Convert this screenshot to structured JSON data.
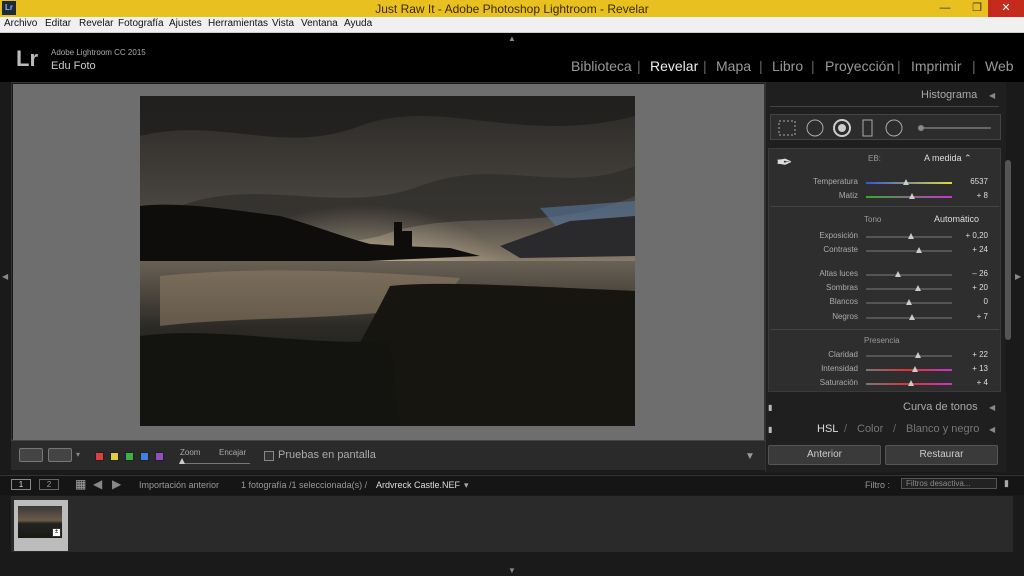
{
  "window": {
    "title": "Just Raw It - Adobe Photoshop Lightroom - Revelar",
    "app_icon": "Lr",
    "minimize": "—",
    "maximize": "❐",
    "close": "✕"
  },
  "menu": [
    "Archivo",
    "Editar",
    "Revelar",
    "Fotografía",
    "Ajustes",
    "Herramientas",
    "Vista",
    "Ventana",
    "Ayuda"
  ],
  "identity": {
    "logo": "Lr",
    "version": "Adobe Lightroom CC 2015",
    "user": "Edu Foto"
  },
  "modules": [
    {
      "label": "Biblioteca",
      "active": false
    },
    {
      "label": "Revelar",
      "active": true
    },
    {
      "label": "Mapa",
      "active": false
    },
    {
      "label": "Libro",
      "active": false
    },
    {
      "label": "Proyección",
      "active": false
    },
    {
      "label": "Imprimir",
      "active": false
    },
    {
      "label": "Web",
      "active": false
    }
  ],
  "module_separator": "|",
  "toolbar": {
    "zoom_label": "Zoom",
    "fit_label": "Encajar",
    "proofing_label": "Pruebas en pantalla",
    "swatches": [
      "#d94040",
      "#e0d040",
      "#40b040",
      "#4080e0",
      "#9050c0"
    ]
  },
  "panel": {
    "histogram_title": "Histograma",
    "wb_label": "EB:",
    "wb_value": "A medida ⌃",
    "temp_sliders": [
      {
        "label": "Temperatura",
        "value": "6537",
        "pos": 0.47,
        "gradient": "linear-gradient(90deg,#3355dd,#dddd33)"
      },
      {
        "label": "Matiz",
        "value": "+ 8",
        "pos": 0.53,
        "gradient": "linear-gradient(90deg,#33aa33,#cc33cc)"
      }
    ],
    "tone_label": "Tono",
    "auto_label": "Automático",
    "tone_sliders": [
      {
        "label": "Exposición",
        "value": "+ 0,20",
        "pos": 0.52
      },
      {
        "label": "Contraste",
        "value": "+ 24",
        "pos": 0.62
      }
    ],
    "light_sliders": [
      {
        "label": "Altas luces",
        "value": "– 26",
        "pos": 0.37
      },
      {
        "label": "Sombras",
        "value": "+ 20",
        "pos": 0.6
      },
      {
        "label": "Blancos",
        "value": "0",
        "pos": 0.5
      },
      {
        "label": "Negros",
        "value": "+ 7",
        "pos": 0.54
      }
    ],
    "presence_label": "Presencia",
    "presence_sliders": [
      {
        "label": "Claridad",
        "value": "+ 22",
        "pos": 0.61,
        "gradient": "#555"
      },
      {
        "label": "Intensidad",
        "value": "+ 13",
        "pos": 0.57,
        "gradient": "linear-gradient(90deg,#777,#dd3333,#cc33cc)"
      },
      {
        "label": "Saturación",
        "value": "+ 4",
        "pos": 0.52,
        "gradient": "linear-gradient(90deg,#777,#dd3333,#cc33cc)"
      }
    ],
    "curve_title": "Curva de tonos",
    "hsl_title": "HSL",
    "color_title": "Color",
    "bw_title": "Blanco y negro",
    "hsl_sep": "/",
    "prev_button": "Anterior",
    "reset_button": "Restaurar"
  },
  "filmbar": {
    "page1": "1",
    "page2": "2",
    "source": "Importación anterior",
    "count": "1 fotografía /1 seleccionada(s) /",
    "filename": "Ardvreck Castle.NEF",
    "filter_label": "Filtro :",
    "filter_value": "Filtros desactiva..."
  }
}
